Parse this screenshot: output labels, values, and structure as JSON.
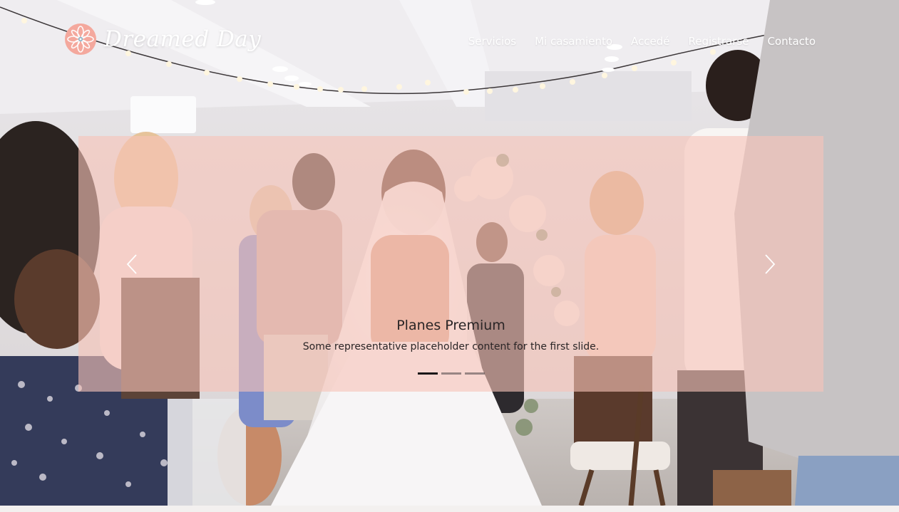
{
  "navbar": {
    "brand_name": "Dreamed Day",
    "brand_logo_icon": "flower-badge-icon",
    "links": [
      {
        "label": "Servicios"
      },
      {
        "label": "Mi casamiento"
      },
      {
        "label": "Accedé"
      },
      {
        "label": "Registrarse"
      },
      {
        "label": "Contacto"
      }
    ]
  },
  "carousel": {
    "prev_icon": "chevron-left-icon",
    "next_icon": "chevron-right-icon",
    "active_slide": 1,
    "slide_count": 3,
    "slide": {
      "title": "Planes Premium",
      "text": "Some representative placeholder content for the first slide."
    }
  },
  "colors": {
    "overlay_pink": "#f7c4b8",
    "logo_pink": "#f4a89d",
    "nav_text": "#ffffff",
    "caption_text": "#2a2526"
  }
}
